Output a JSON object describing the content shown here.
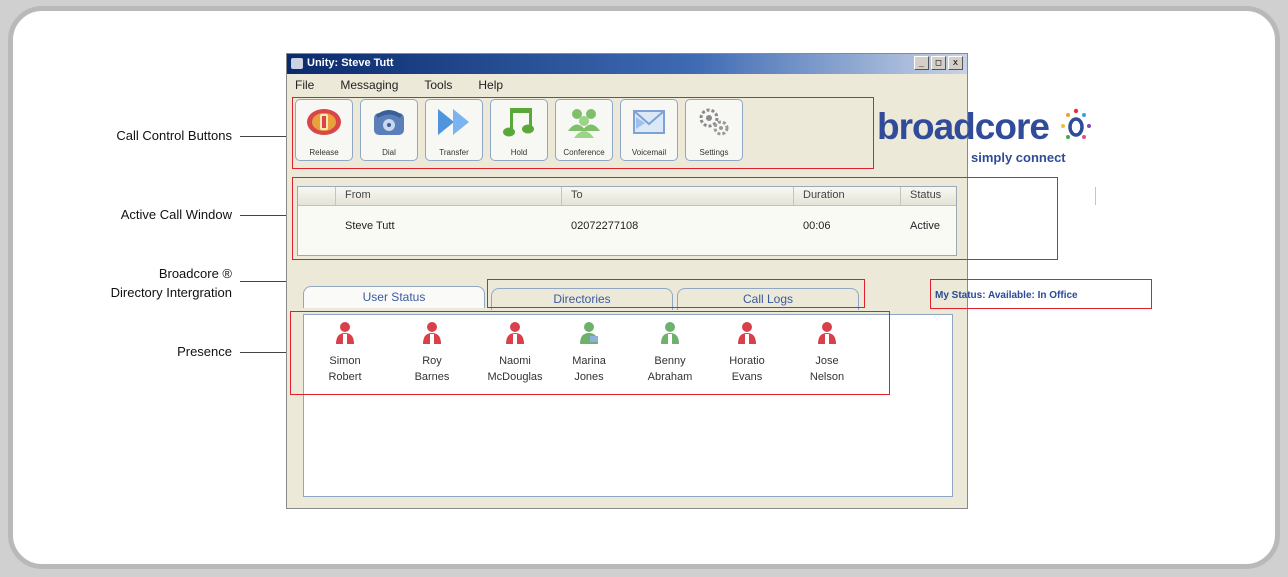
{
  "annotations": {
    "call_control": "Call Control Buttons",
    "active_call": "Active Call Window",
    "directory_line1": "Broadcore ®",
    "directory_line2": "Directory Intergration",
    "presence": "Presence"
  },
  "window": {
    "title": "Unity: Steve Tutt",
    "min": "_",
    "max": "□",
    "close": "x"
  },
  "menu": [
    "File",
    "Messaging",
    "Tools",
    "Help"
  ],
  "toolbar": [
    {
      "label": "Release",
      "icon": "release-icon"
    },
    {
      "label": "Dial",
      "icon": "phone-icon"
    },
    {
      "label": "Transfer",
      "icon": "transfer-icon"
    },
    {
      "label": "Hold",
      "icon": "music-note-icon"
    },
    {
      "label": "Conference",
      "icon": "conference-icon"
    },
    {
      "label": "Voicemail",
      "icon": "envelope-icon"
    },
    {
      "label": "Settings",
      "icon": "gears-icon"
    }
  ],
  "logo": {
    "brand": "broadcore",
    "tagline": "simply connect"
  },
  "call_table": {
    "columns": [
      "From",
      "To",
      "Duration",
      "Status"
    ],
    "rows": [
      [
        "Steve Tutt",
        "02072277108",
        "00:06",
        "Active"
      ]
    ]
  },
  "tabs": [
    "User Status",
    "Directories",
    "Call Logs"
  ],
  "my_status": "My Status: Available: In Office",
  "contacts": [
    {
      "first": "Simon",
      "last": "Robert",
      "status": "busy"
    },
    {
      "first": "Roy",
      "last": "Barnes",
      "status": "busy"
    },
    {
      "first": "Naomi",
      "last": "McDouglas",
      "status": "busy"
    },
    {
      "first": "Marina",
      "last": "Jones",
      "status": "available"
    },
    {
      "first": "Benny",
      "last": "Abraham",
      "status": "available"
    },
    {
      "first": "Horatio",
      "last": "Evans",
      "status": "busy"
    },
    {
      "first": "Jose",
      "last": "Nelson",
      "status": "busy"
    }
  ],
  "colors": {
    "highlight_box": "#e0202a",
    "brand_blue": "#2f4b9a",
    "presence_busy": "#d9404a",
    "presence_available": "#6cb26a"
  }
}
